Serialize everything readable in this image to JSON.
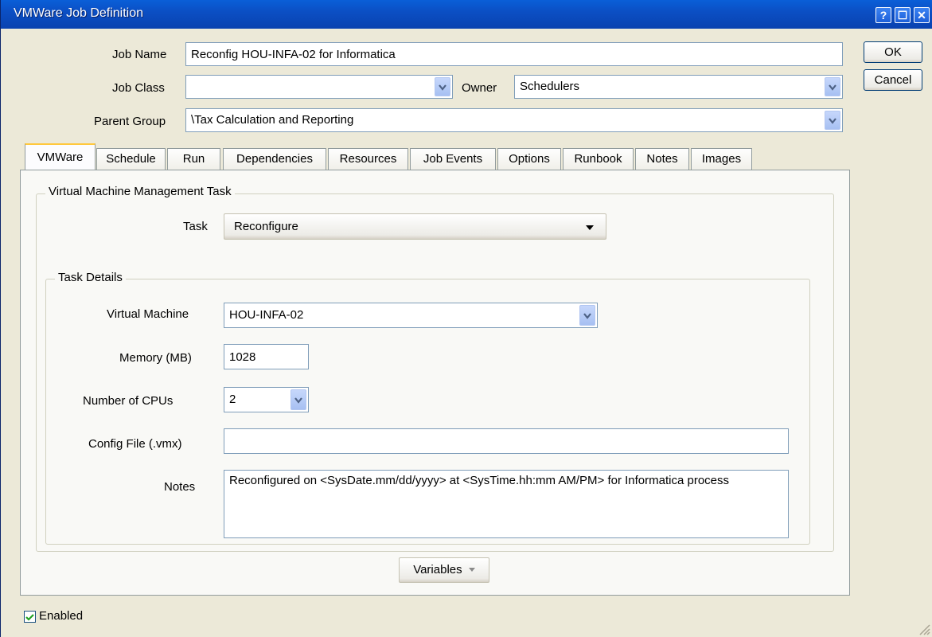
{
  "window": {
    "title": "VMWare Job Definition",
    "help_glyph": "?",
    "max_glyph": "☐",
    "close_glyph": "✕"
  },
  "header": {
    "job_name_label": "Job Name",
    "job_name_value": "Reconfig HOU-INFA-02 for Informatica",
    "job_class_label": "Job Class",
    "job_class_value": "",
    "owner_label": "Owner",
    "owner_value": "Schedulers",
    "parent_group_label": "Parent Group",
    "parent_group_value": "\\Tax Calculation and Reporting"
  },
  "buttons": {
    "ok": "OK",
    "cancel": "Cancel",
    "variables": "Variables"
  },
  "tabs": [
    {
      "label": "VMWare",
      "active": true
    },
    {
      "label": "Schedule"
    },
    {
      "label": "Run"
    },
    {
      "label": "Dependencies"
    },
    {
      "label": "Resources"
    },
    {
      "label": "Job Events"
    },
    {
      "label": "Options"
    },
    {
      "label": "Runbook"
    },
    {
      "label": "Notes"
    },
    {
      "label": "Images"
    }
  ],
  "vm_task": {
    "group_title": "Virtual Machine Management Task",
    "task_label": "Task",
    "task_value": "Reconfigure"
  },
  "task_details": {
    "group_title": "Task Details",
    "vm_label": "Virtual Machine",
    "vm_value": "HOU-INFA-02",
    "memory_label": "Memory (MB)",
    "memory_value": "1028",
    "cpus_label": "Number of CPUs",
    "cpus_value": "2",
    "config_label": "Config File (.vmx)",
    "config_value": "",
    "notes_label": "Notes",
    "notes_value": "Reconfigured on <SysDate.mm/dd/yyyy> at <SysTime.hh:mm AM/PM> for Informatica process"
  },
  "footer": {
    "enabled_label": "Enabled",
    "enabled_checked": true
  },
  "colors": {
    "titlebar": "#0a4fc4",
    "dialog_bg": "#ece9d8",
    "tab_active_accent": "#ffc83c",
    "check_mark": "#21a121"
  }
}
